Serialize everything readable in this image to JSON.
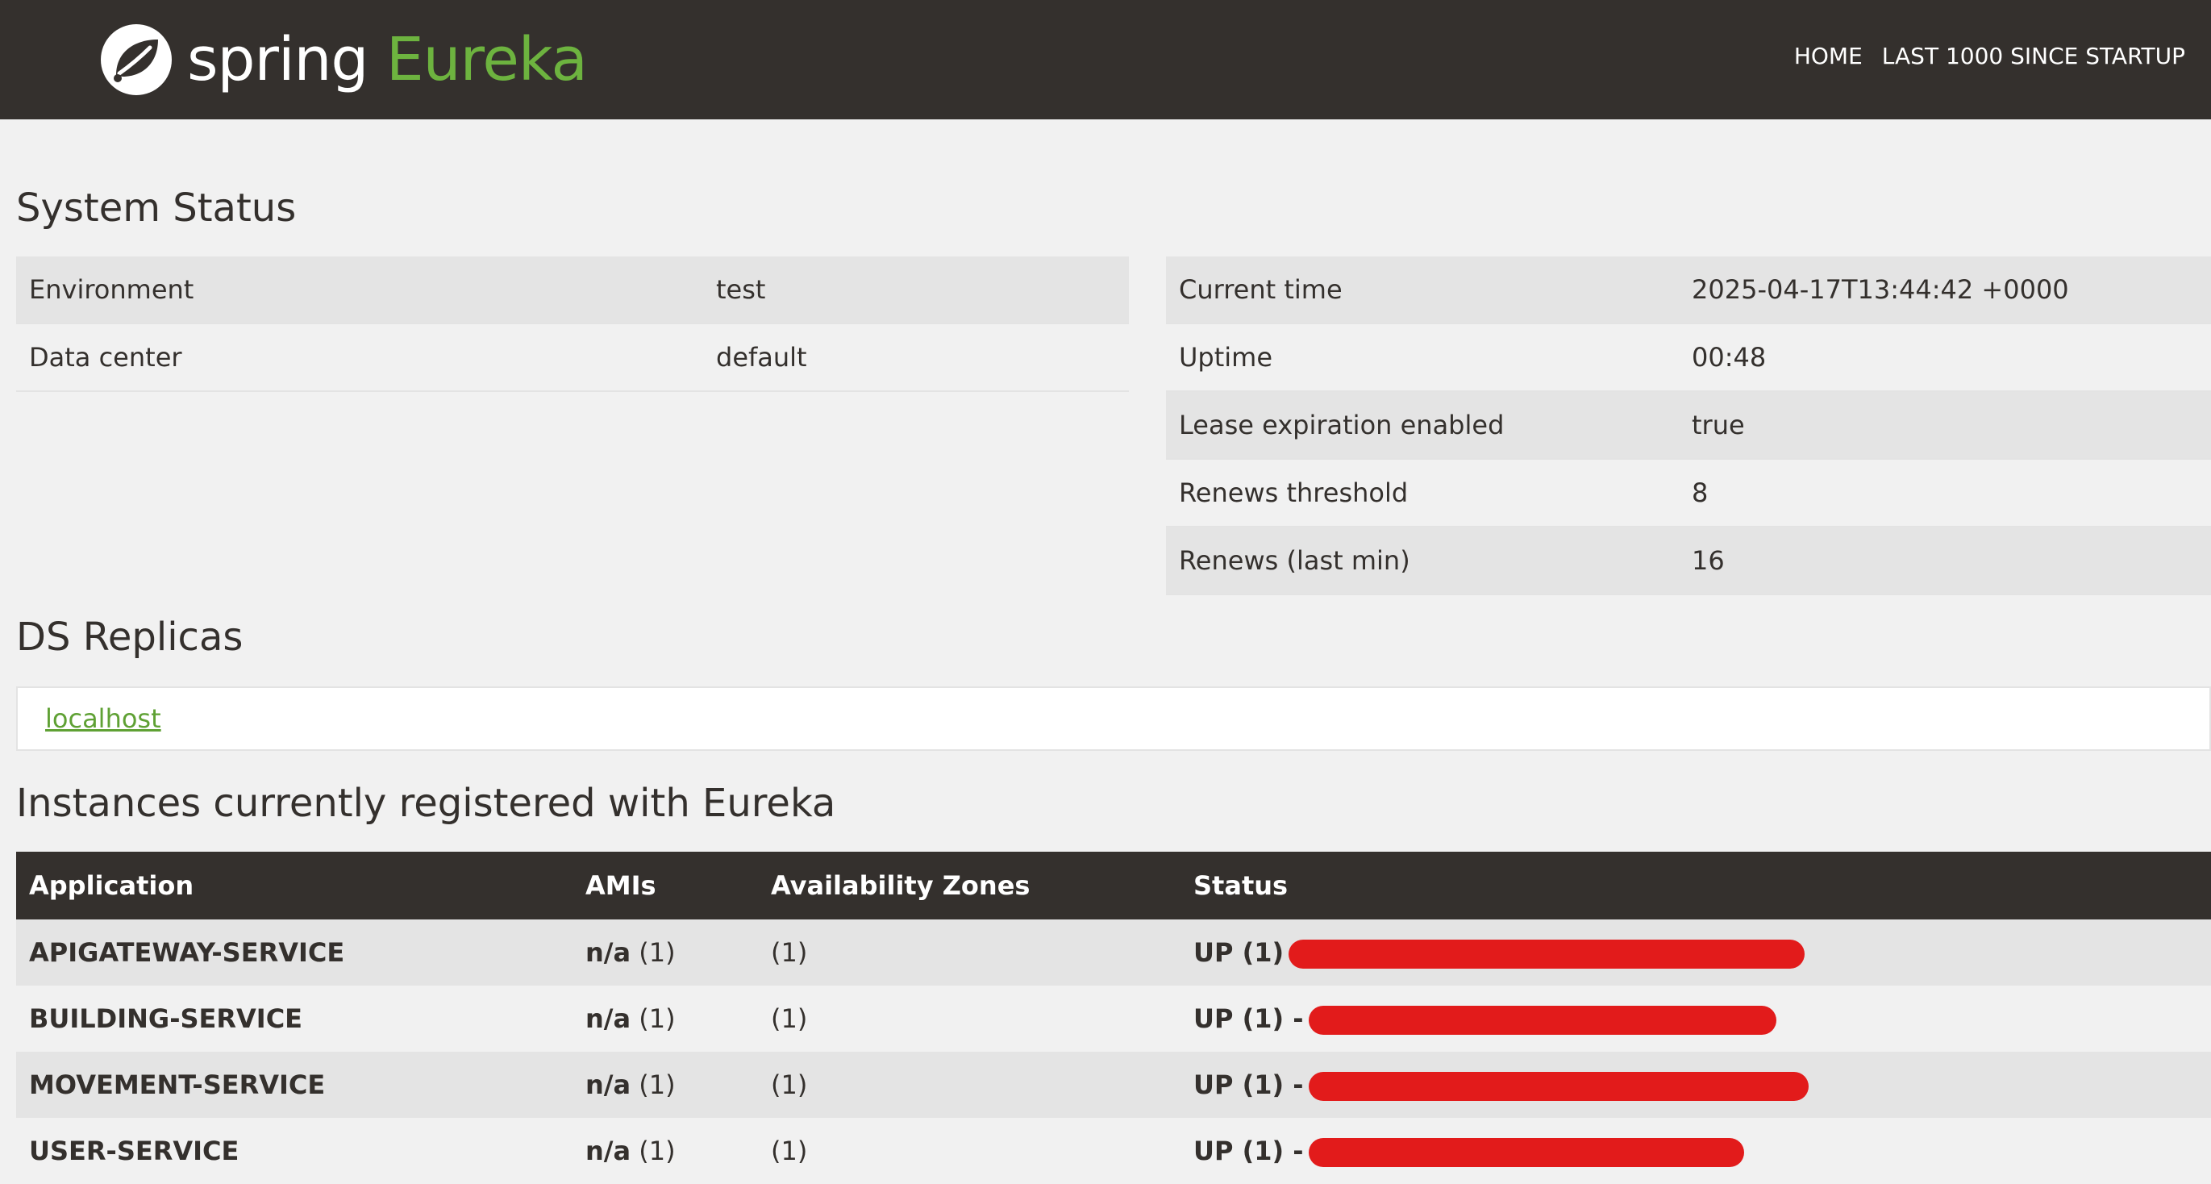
{
  "header": {
    "brand_spring": "spring",
    "brand_eureka": "Eureka",
    "nav": [
      "HOME",
      "LAST 1000 SINCE STARTUP"
    ],
    "colors": {
      "bar": "#34302d",
      "accent": "#6db33f"
    }
  },
  "system_status": {
    "title": "System Status",
    "left": [
      {
        "label": "Environment",
        "value": "test"
      },
      {
        "label": "Data center",
        "value": "default"
      }
    ],
    "right": [
      {
        "label": "Current time",
        "value": "2025-04-17T13:44:42 +0000"
      },
      {
        "label": "Uptime",
        "value": "00:48"
      },
      {
        "label": "Lease expiration enabled",
        "value": "true"
      },
      {
        "label": "Renews threshold",
        "value": "8"
      },
      {
        "label": "Renews (last min)",
        "value": "16"
      }
    ]
  },
  "ds_replicas": {
    "title": "DS Replicas",
    "link": "localhost"
  },
  "instances": {
    "title": "Instances currently registered with Eureka",
    "columns": [
      "Application",
      "AMIs",
      "Availability Zones",
      "Status"
    ],
    "rows": [
      {
        "app": "APIGATEWAY-SERVICE",
        "ami": "n/a",
        "ami_count": "(1)",
        "zones": "(1)",
        "status": "UP (1)"
      },
      {
        "app": "BUILDING-SERVICE",
        "ami": "n/a",
        "ami_count": "(1)",
        "zones": "(1)",
        "status": "UP (1) -"
      },
      {
        "app": "MOVEMENT-SERVICE",
        "ami": "n/a",
        "ami_count": "(1)",
        "zones": "(1)",
        "status": "UP (1) -"
      },
      {
        "app": "USER-SERVICE",
        "ami": "n/a",
        "ami_count": "(1)",
        "zones": "(1)",
        "status": "UP (1) -"
      }
    ],
    "redaction_color": "#e21b1b"
  }
}
